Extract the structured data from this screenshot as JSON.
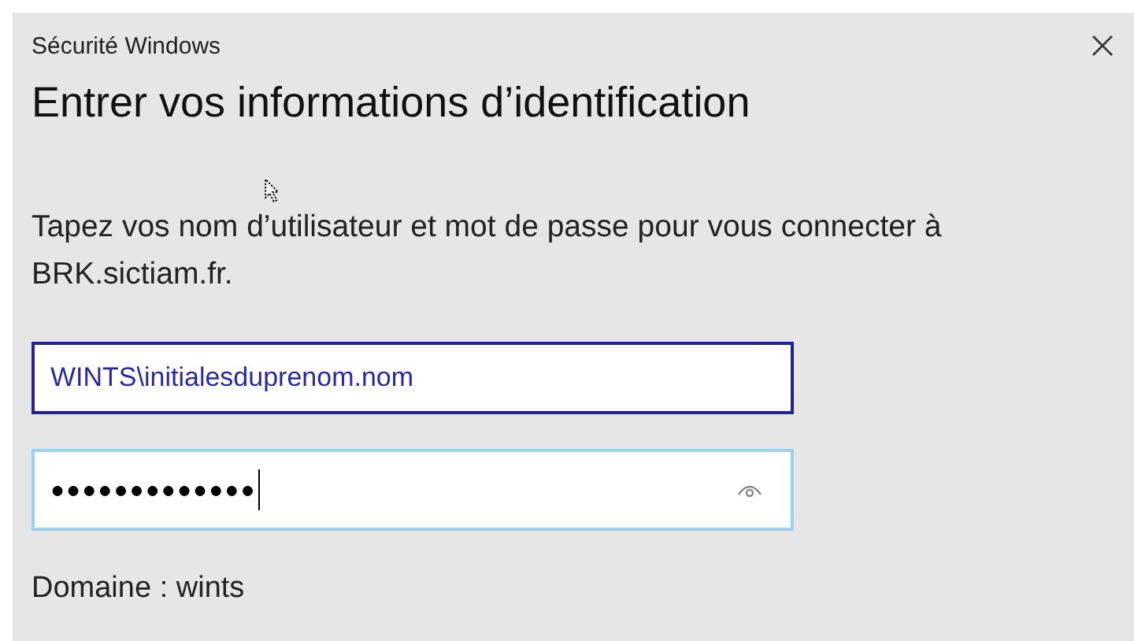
{
  "window": {
    "title": "Sécurité Windows"
  },
  "heading": "Entrer vos informations d’identification",
  "description": "Tapez vos nom d’utilisateur et mot de passe pour vous connecter à BRK.sictiam.fr.",
  "username": {
    "value": "WINTS\\initialesduprenom.nom",
    "highlighted": true
  },
  "password": {
    "value": "●●●●●●●●●●●●●",
    "focused": true
  },
  "domain": "Domaine : wints"
}
